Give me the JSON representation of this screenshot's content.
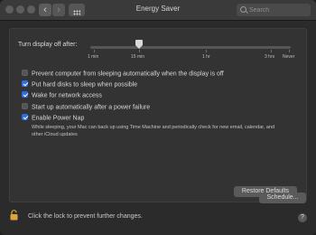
{
  "window": {
    "title": "Energy Saver",
    "nav_back": "‹",
    "nav_forward": "›"
  },
  "search": {
    "placeholder": "Search"
  },
  "display_sleep": {
    "label": "Turn display off after:",
    "value": "15 min",
    "ticks": [
      "1 min",
      "15 min",
      "1 hr",
      "3 hrs",
      "Never"
    ]
  },
  "options": [
    {
      "label": "Prevent computer from sleeping automatically when the display is off",
      "checked": false
    },
    {
      "label": "Put hard disks to sleep when possible",
      "checked": true
    },
    {
      "label": "Wake for network access",
      "checked": true
    },
    {
      "label": "Start up automatically after a power failure",
      "checked": false
    },
    {
      "label": "Enable Power Nap",
      "checked": true
    }
  ],
  "power_nap_description": "While sleeping, your Mac can back up using Time Machine and periodically check for new email, calendar, and other iCloud updates",
  "buttons": {
    "restore_defaults": "Restore Defaults",
    "schedule": "Schedule..."
  },
  "footer": {
    "lock_text": "Click the lock to prevent further changes.",
    "help": "?"
  },
  "colors": {
    "accent": "#2f6fe4",
    "lock": "#e0a53a"
  }
}
